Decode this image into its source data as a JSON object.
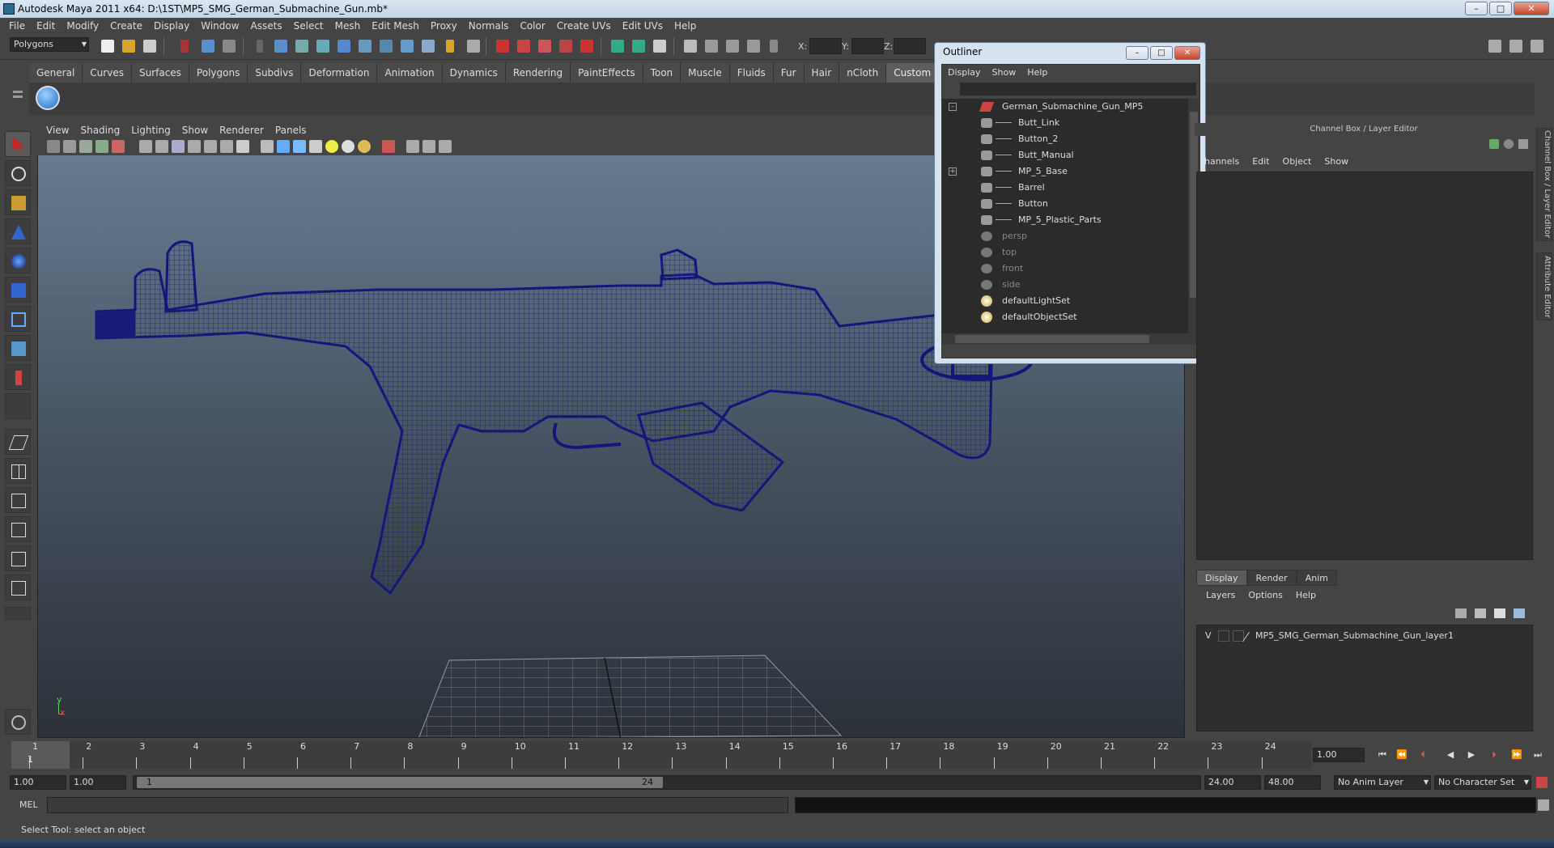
{
  "window": {
    "title": "Autodesk Maya 2011 x64: D:\\1ST\\MP5_SMG_German_Submachine_Gun.mb*",
    "min": "–",
    "max": "□",
    "close": "✕"
  },
  "menubar": [
    "File",
    "Edit",
    "Modify",
    "Create",
    "Display",
    "Window",
    "Assets",
    "Select",
    "Mesh",
    "Edit Mesh",
    "Proxy",
    "Normals",
    "Color",
    "Create UVs",
    "Edit UVs",
    "Help"
  ],
  "statusline": {
    "mode": "Polygons",
    "x_label": "X:",
    "y_label": "Y:",
    "z_label": "Z:"
  },
  "shelf": {
    "tabs": [
      "General",
      "Curves",
      "Surfaces",
      "Polygons",
      "Subdivs",
      "Deformation",
      "Animation",
      "Dynamics",
      "Rendering",
      "PaintEffects",
      "Toon",
      "Muscle",
      "Fluids",
      "Fur",
      "Hair",
      "nCloth",
      "Custom"
    ],
    "active": "Custom"
  },
  "viewport": {
    "menu": [
      "View",
      "Shading",
      "Lighting",
      "Show",
      "Renderer",
      "Panels"
    ],
    "axis_y": "y",
    "axis_x": "x",
    "wire_color": "#1a1a78"
  },
  "outliner": {
    "title": "Outliner",
    "menu": [
      "Display",
      "Show",
      "Help"
    ],
    "items": [
      {
        "label": "German_Submachine_Gun_MP5",
        "expander": "–"
      },
      {
        "label": "Butt_Link"
      },
      {
        "label": "Button_2"
      },
      {
        "label": "Butt_Manual"
      },
      {
        "label": "MP_5_Base",
        "expander": "+"
      },
      {
        "label": "Barrel"
      },
      {
        "label": "Button"
      },
      {
        "label": "MP_5_Plastic_Parts"
      },
      {
        "label": "persp"
      },
      {
        "label": "top"
      },
      {
        "label": "front"
      },
      {
        "label": "side"
      },
      {
        "label": "defaultLightSet"
      },
      {
        "label": "defaultObjectSet"
      }
    ]
  },
  "channelbox": {
    "header": "Channel Box / Layer Editor",
    "menu": [
      "hannels",
      "Edit",
      "Object",
      "Show"
    ]
  },
  "layers": {
    "tabs": [
      "Display",
      "Render",
      "Anim"
    ],
    "active": "Display",
    "menu": [
      "Layers",
      "Options",
      "Help"
    ],
    "row_v": "V",
    "row_name": "MP5_SMG_German_Submachine_Gun_layer1"
  },
  "sidetabs": {
    "a": "Channel Box / Layer Editor",
    "b": "Attribute Editor"
  },
  "timeline": {
    "frames": [
      "1",
      "2",
      "3",
      "4",
      "5",
      "6",
      "7",
      "8",
      "9",
      "10",
      "11",
      "12",
      "13",
      "14",
      "15",
      "16",
      "17",
      "18",
      "19",
      "20",
      "21",
      "22",
      "23",
      "24"
    ],
    "current_marker": "1",
    "current_frame": "1.00"
  },
  "range": {
    "start": "1.00",
    "inner_start": "1.00",
    "slider_start": "1",
    "slider_end": "24",
    "end": "24.00",
    "outer_end": "48.00",
    "anim_layer": "No Anim Layer",
    "char_set": "No Character Set"
  },
  "mel": {
    "label": "MEL"
  },
  "help": {
    "text": "Select Tool: select an object"
  }
}
